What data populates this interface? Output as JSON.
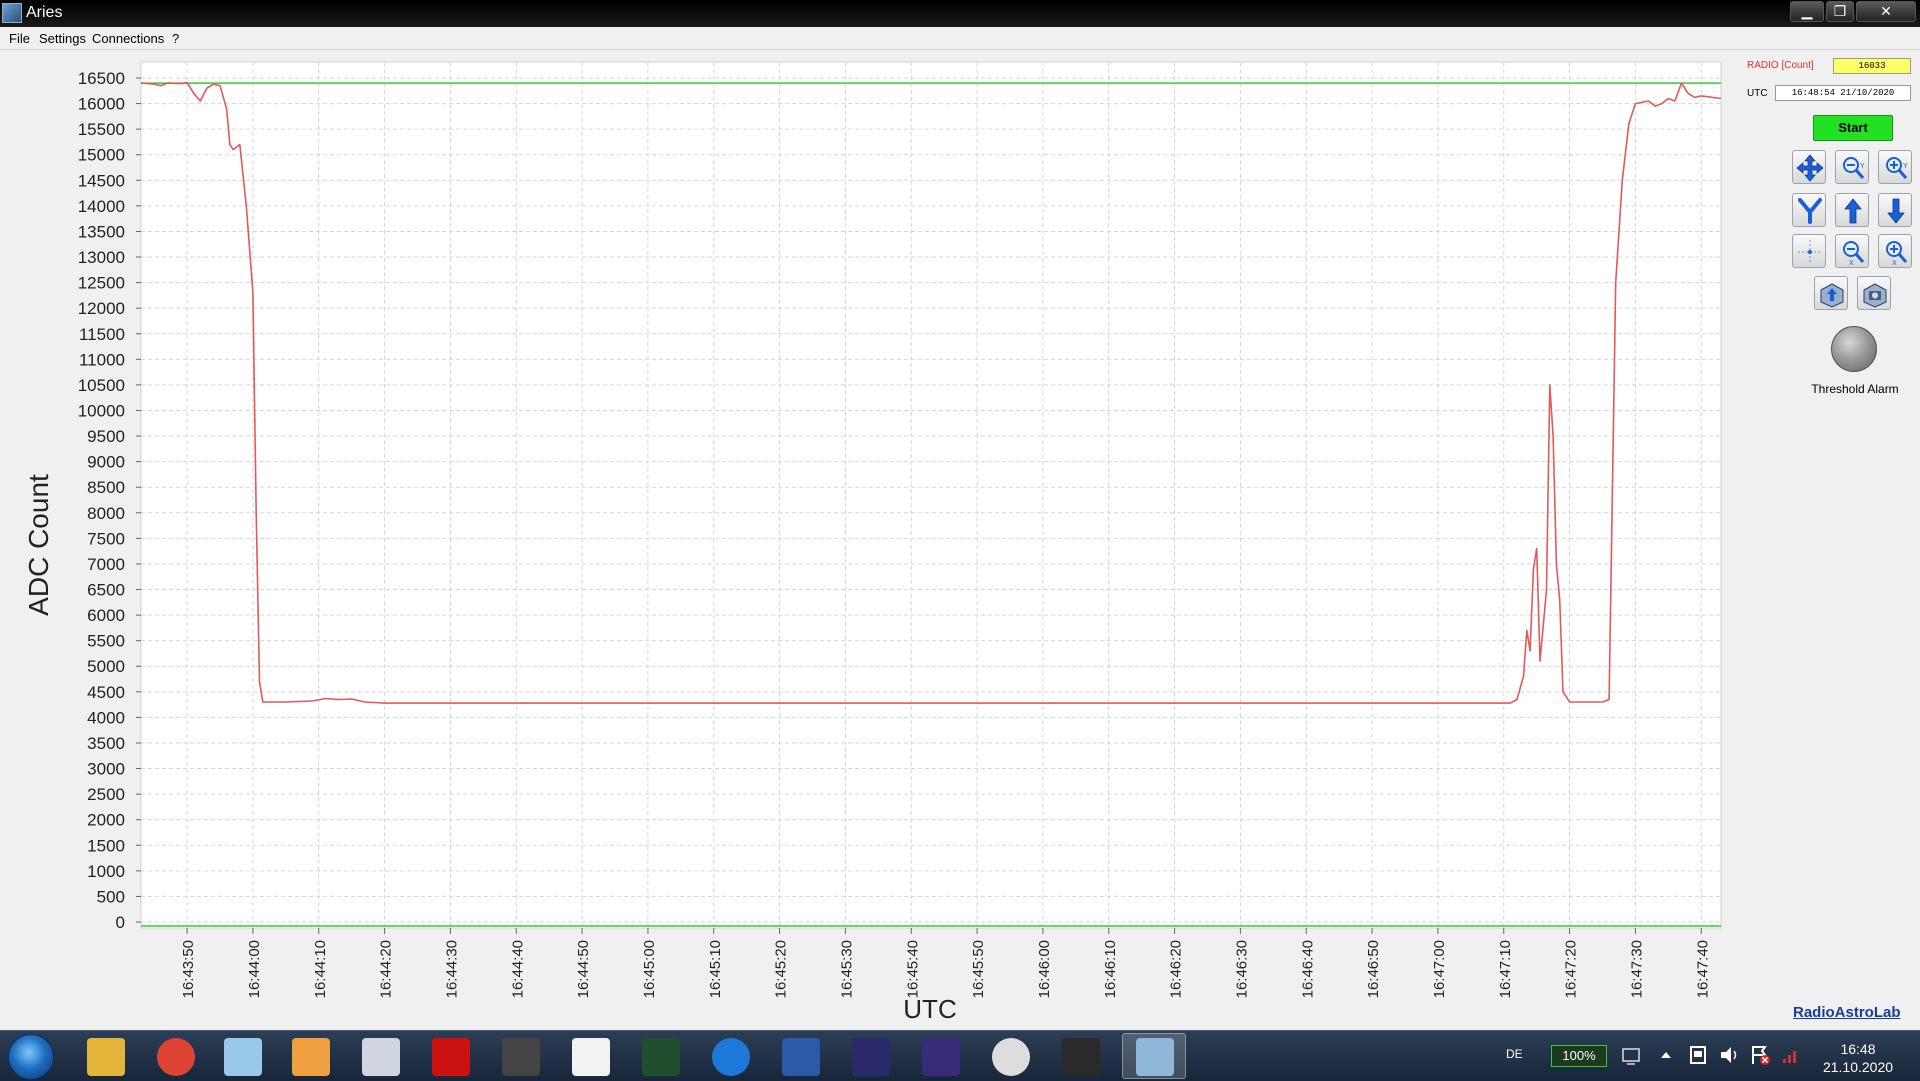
{
  "window": {
    "title": "Aries",
    "minimize_glyph": "▁",
    "maximize_glyph": "❐",
    "close_glyph": "✕"
  },
  "menu": {
    "file": "File",
    "settings": "Settings",
    "connections": "Connections",
    "help": "?"
  },
  "chart_data": {
    "type": "line",
    "xlabel": "UTC",
    "ylabel": "ADC Count",
    "ylim": [
      0,
      16500
    ],
    "yticks": [
      0,
      500,
      1000,
      1500,
      2000,
      2500,
      3000,
      3500,
      4000,
      4500,
      5000,
      5500,
      6000,
      6500,
      7000,
      7500,
      8000,
      8500,
      9000,
      9500,
      10000,
      10500,
      11000,
      11500,
      12000,
      12500,
      13000,
      13500,
      14000,
      14500,
      15000,
      15500,
      16000,
      16500
    ],
    "xlim": [
      "16:43:43",
      "16:47:43"
    ],
    "xticks": [
      "16:43:50",
      "16:44:00",
      "16:44:10",
      "16:44:20",
      "16:44:30",
      "16:44:40",
      "16:44:50",
      "16:45:00",
      "16:45:10",
      "16:45:20",
      "16:45:30",
      "16:45:40",
      "16:45:50",
      "16:46:00",
      "16:46:10",
      "16:46:20",
      "16:46:30",
      "16:46:40",
      "16:46:50",
      "16:47:00",
      "16:47:10",
      "16:47:20",
      "16:47:30",
      "16:47:40"
    ],
    "grid": true,
    "threshold": {
      "value": 16400,
      "color": "#33cc33"
    },
    "baseline": {
      "value": 0,
      "color": "#33cc33"
    },
    "series": [
      {
        "color": "#e05a5a",
        "points": [
          [
            "16:43:43",
            16400
          ],
          [
            "16:43:45",
            16380
          ],
          [
            "16:43:46",
            16350
          ],
          [
            "16:43:47",
            16400
          ],
          [
            "16:43:49",
            16390
          ],
          [
            "16:43:50",
            16410
          ],
          [
            "16:43:51",
            16200
          ],
          [
            "16:43:52",
            16050
          ],
          [
            "16:43:53",
            16300
          ],
          [
            "16:43:54",
            16380
          ],
          [
            "16:43:55",
            16350
          ],
          [
            "16:43:56",
            15900
          ],
          [
            "16:43:56.5",
            15200
          ],
          [
            "16:43:57",
            15100
          ],
          [
            "16:43:58",
            15200
          ],
          [
            "16:43:59",
            14000
          ],
          [
            "16:44:00",
            12300
          ],
          [
            "16:44:00.5",
            8000
          ],
          [
            "16:44:01",
            4700
          ],
          [
            "16:44:01.5",
            4300
          ],
          [
            "16:44:05",
            4300
          ],
          [
            "16:44:09",
            4320
          ],
          [
            "16:44:11",
            4370
          ],
          [
            "16:44:13",
            4350
          ],
          [
            "16:44:15",
            4360
          ],
          [
            "16:44:17",
            4300
          ],
          [
            "16:44:20",
            4280
          ],
          [
            "16:45:00",
            4280
          ],
          [
            "16:46:00",
            4280
          ],
          [
            "16:47:00",
            4280
          ],
          [
            "16:47:11",
            4280
          ],
          [
            "16:47:12",
            4350
          ],
          [
            "16:47:13",
            4800
          ],
          [
            "16:47:13.5",
            5700
          ],
          [
            "16:47:14",
            5300
          ],
          [
            "16:47:14.5",
            6900
          ],
          [
            "16:47:15",
            7300
          ],
          [
            "16:47:15.5",
            5100
          ],
          [
            "16:47:16",
            5800
          ],
          [
            "16:47:16.5",
            6500
          ],
          [
            "16:47:17",
            10500
          ],
          [
            "16:47:17.5",
            9500
          ],
          [
            "16:47:18",
            7000
          ],
          [
            "16:47:18.5",
            6300
          ],
          [
            "16:47:19",
            4500
          ],
          [
            "16:47:20",
            4300
          ],
          [
            "16:47:25",
            4300
          ],
          [
            "16:47:26",
            4350
          ],
          [
            "16:47:27",
            12500
          ],
          [
            "16:47:28",
            14500
          ],
          [
            "16:47:29",
            15600
          ],
          [
            "16:47:30",
            16000
          ],
          [
            "16:47:32",
            16050
          ],
          [
            "16:47:33",
            15950
          ],
          [
            "16:47:34",
            16000
          ],
          [
            "16:47:35",
            16100
          ],
          [
            "16:47:36",
            16050
          ],
          [
            "16:47:37",
            16400
          ],
          [
            "16:47:38",
            16200
          ],
          [
            "16:47:39",
            16120
          ],
          [
            "16:47:40",
            16150
          ],
          [
            "16:47:43",
            16100
          ]
        ]
      }
    ]
  },
  "side": {
    "radio_label": "RADIO [Count]",
    "radio_value": "16033",
    "utc_label": "UTC",
    "utc_value": "16:48:54  21/10/2020",
    "start_label": "Start",
    "alarm_label": "Threshold Alarm",
    "brand": "RadioAstroLab",
    "tools": [
      "pan-icon",
      "zoom-out-y-icon",
      "zoom-in-y-icon",
      "y-autoscale-icon",
      "scroll-up-icon",
      "scroll-down-icon",
      "crosshair-icon",
      "zoom-out-x-icon",
      "zoom-in-x-icon",
      "save-image-icon",
      "camera-icon"
    ],
    "colors": {
      "radio_label": "#e03030",
      "radio_box": "#ffff66",
      "start": "#22e022"
    }
  },
  "taskbar": {
    "lang": "DE",
    "battery": "100%",
    "time": "16:48",
    "date": "21.10.2020",
    "apps": [
      "windows-explorer-icon",
      "chrome-icon",
      "notepad-icon",
      "paint-icon",
      "satellite-dish-icon",
      "red-app-icon",
      "microphone-icon",
      "clapperboard-icon",
      "monitor-icon",
      "teamviewer-icon",
      "word-icon",
      "night-sky-icon",
      "radio-telescope-icon",
      "spiderweb-icon",
      "terminal-icon",
      "aries-icon"
    ]
  }
}
